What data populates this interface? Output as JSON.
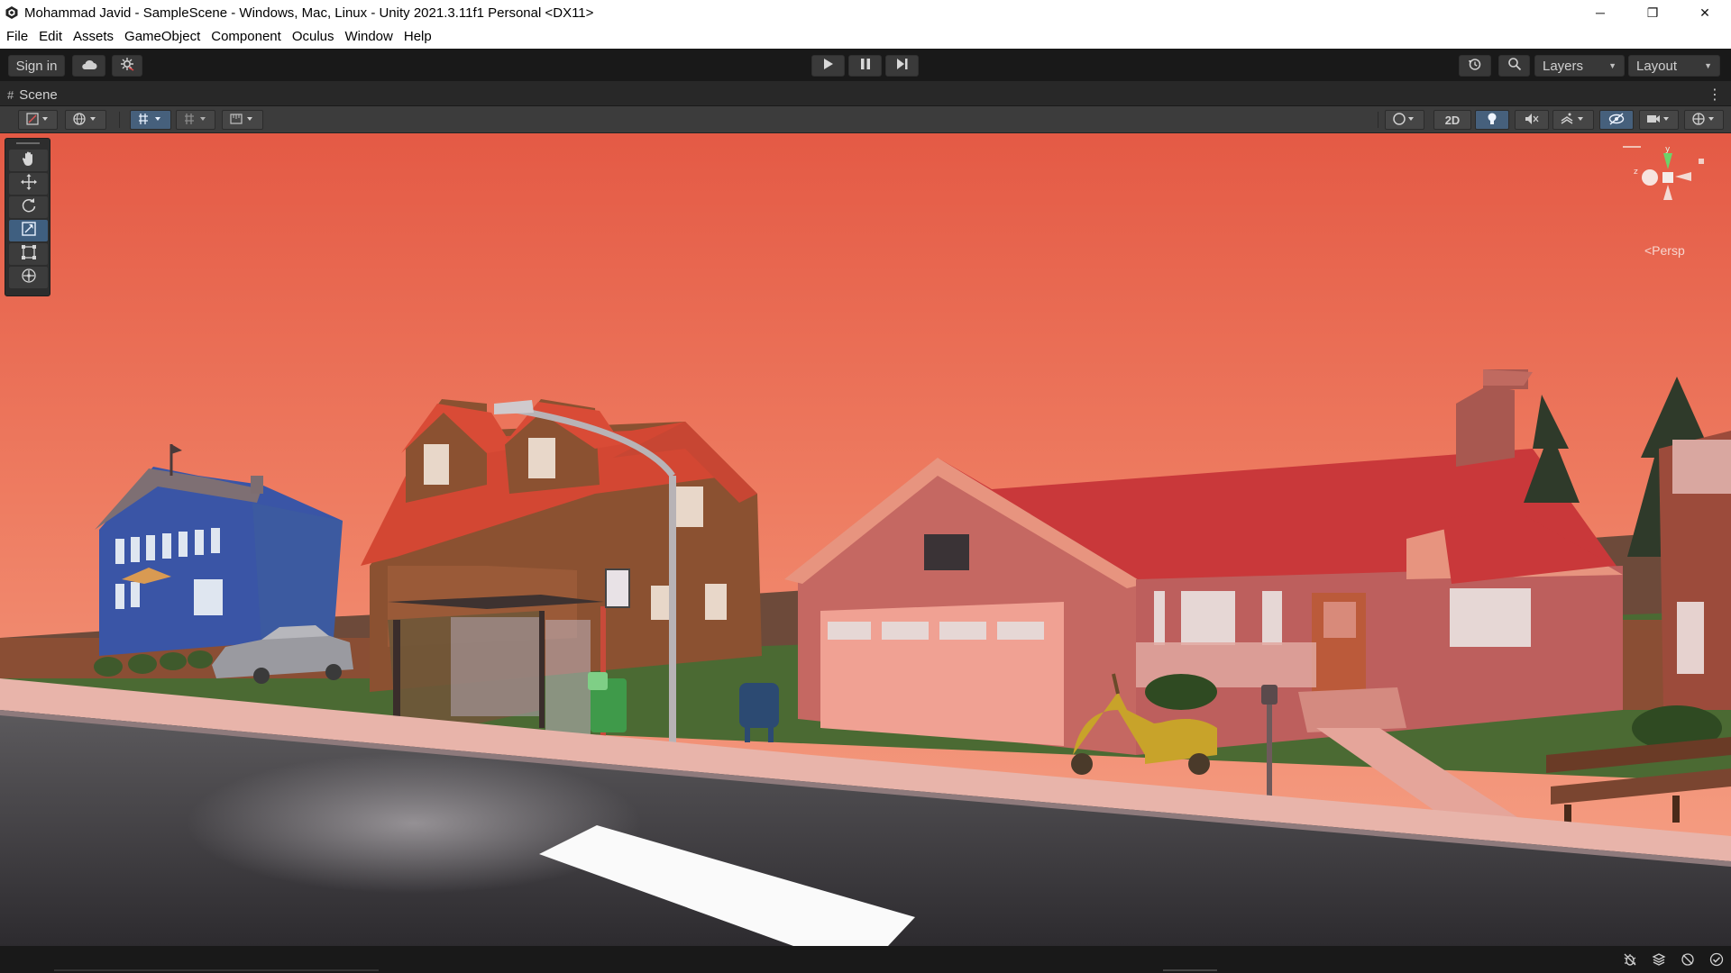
{
  "window": {
    "title": "Mohammad Javid - SampleScene - Windows, Mac, Linux - Unity 2021.3.11f1 Personal <DX11>",
    "icon": "unity-logo-icon",
    "controls": {
      "minimize": "─",
      "restore": "❐",
      "close": "✕"
    }
  },
  "menubar": {
    "items": [
      "File",
      "Edit",
      "Assets",
      "GameObject",
      "Component",
      "Oculus",
      "Window",
      "Help"
    ]
  },
  "toolbar": {
    "sign_in": "Sign in",
    "cloud_icon": "cloud-icon",
    "collab_icon": "collab-icon",
    "play_icon": "play-icon",
    "pause_icon": "pause-icon",
    "step_icon": "step-icon",
    "history_icon": "history-icon",
    "search_icon": "search-icon",
    "layers_label": "Layers",
    "layout_label": "Layout"
  },
  "scene_tab": {
    "label": "Scene",
    "menu_glyph": "⋮"
  },
  "scene_toolbar": {
    "mode_2d": "2D"
  },
  "viewport": {
    "projection_label": "<Persp",
    "sky_top": "#e5604a",
    "sky_bottom": "#f39a7c"
  },
  "tools": [
    "hand-tool",
    "move-tool",
    "rotate-tool",
    "scale-tool",
    "rect-tool",
    "transform-tool"
  ],
  "active_tool": "scale-tool",
  "colors": {
    "accent_active": "#46607c",
    "editor_dark": "#191919"
  }
}
